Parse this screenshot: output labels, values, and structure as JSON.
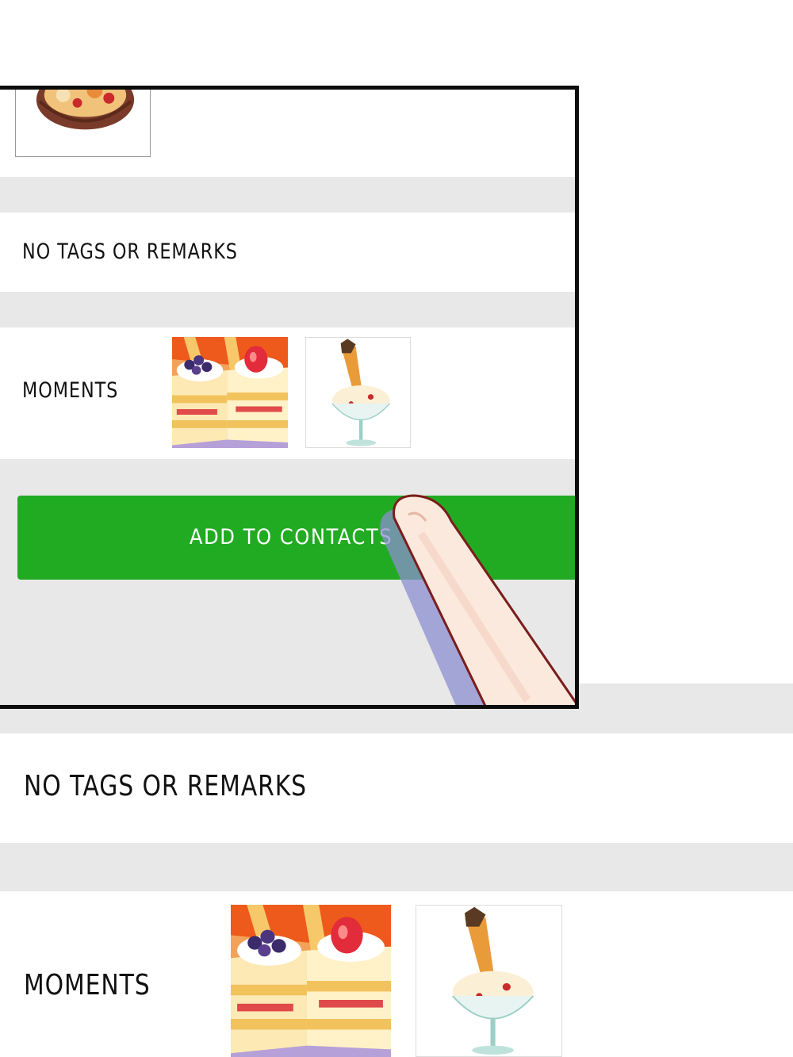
{
  "panel": {
    "tags_label": "NO TAGS OR REMARKS",
    "moments_label": "MOMENTS",
    "add_button_label": "ADD TO CONTACTS",
    "moments_photos": [
      "cake-photo",
      "ice-cream-sundae-photo"
    ]
  },
  "page": {
    "tags_label": "NO TAGS OR REMARKS",
    "moments_label": "MOMENTS",
    "moments_photos": [
      "cake-photo",
      "ice-cream-sundae-photo"
    ]
  },
  "colors": {
    "button_green": "#21ab22",
    "divider_gray": "#e8e8e8",
    "panel_border": "#0d0d0d"
  }
}
